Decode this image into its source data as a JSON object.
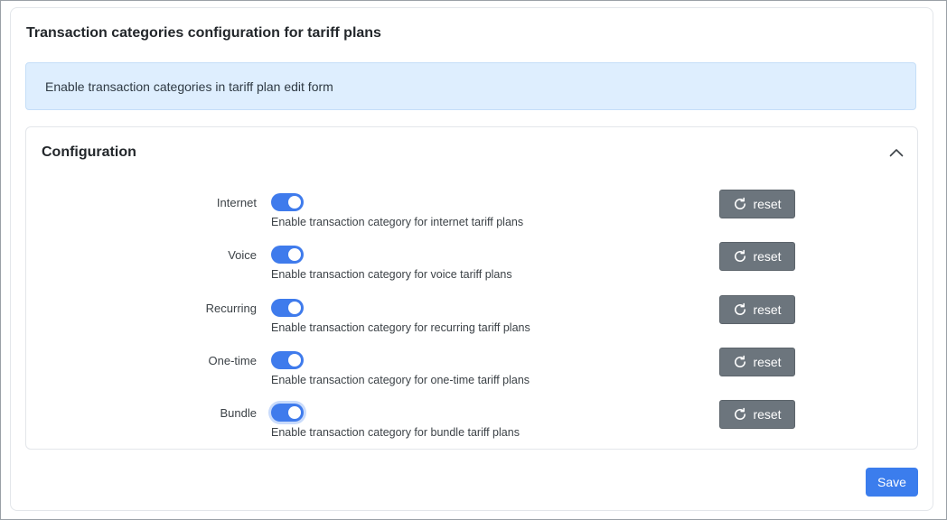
{
  "page": {
    "title": "Transaction categories configuration for tariff plans",
    "info_banner": "Enable transaction categories in tariff plan edit form"
  },
  "config": {
    "title": "Configuration",
    "collapse_icon": "chevron-up-icon",
    "rows": [
      {
        "label": "Internet",
        "enabled": true,
        "help": "Enable transaction category for internet tariff plans",
        "reset_label": "reset"
      },
      {
        "label": "Voice",
        "enabled": true,
        "help": "Enable transaction category for voice tariff plans",
        "reset_label": "reset"
      },
      {
        "label": "Recurring",
        "enabled": true,
        "help": "Enable transaction category for recurring tariff plans",
        "reset_label": "reset"
      },
      {
        "label": "One-time",
        "enabled": true,
        "help": "Enable transaction category for one-time tariff plans",
        "reset_label": "reset"
      },
      {
        "label": "Bundle",
        "enabled": true,
        "help": "Enable transaction category for bundle tariff plans",
        "reset_label": "reset"
      }
    ]
  },
  "actions": {
    "save_label": "Save"
  },
  "colors": {
    "accent": "#3b7ded",
    "banner_bg": "#deeefe",
    "reset_bg": "#6c757d"
  }
}
